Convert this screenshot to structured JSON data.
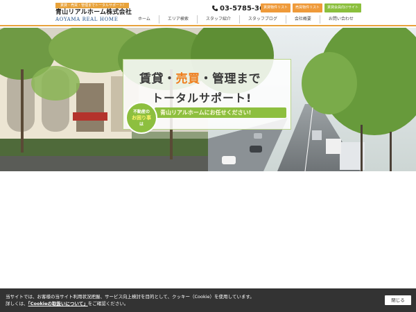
{
  "header": {
    "tagline": "賃貸・売買・管理までトータルサポート!",
    "company_name": "青山リアルホーム株式会社",
    "company_name_en": "AOYAMA REAL HOME",
    "phone": "03-5785-3637",
    "phone_icon": "phone-icon",
    "buttons": [
      {
        "label": "賃貸物件リスト",
        "color": "#ef9a3a"
      },
      {
        "label": "売買物件リスト",
        "color": "#ef9a3a"
      },
      {
        "label": "賃貸会員向けサイト",
        "color": "#8bbf3d"
      }
    ],
    "nav": [
      "ホーム",
      "エリア検索",
      "スタッフ紹介",
      "スタッフブログ",
      "会社概要",
      "お問い合わせ"
    ],
    "accent_color": "#e8a23a"
  },
  "hero": {
    "copy_part1": "賃貸・",
    "copy_highlight": "売買",
    "copy_part2": "・管理まで",
    "copy_line2": "トータルサポート!",
    "copy_line3": "青山リアルホームにお任せください!",
    "circle_line1": "不動産の",
    "circle_em": "お困り事",
    "circle_line3": "は"
  },
  "cookie": {
    "text1": "当サイトでは、お客様の当サイト利用状況把握、サービス向上検討を目的として、クッキー（Cookie）を使用しています。",
    "text2_before": "詳しくは、",
    "link": "「Cookieの取扱いについて」",
    "text2_after": "をご確認ください。",
    "close_label": "閉じる"
  }
}
